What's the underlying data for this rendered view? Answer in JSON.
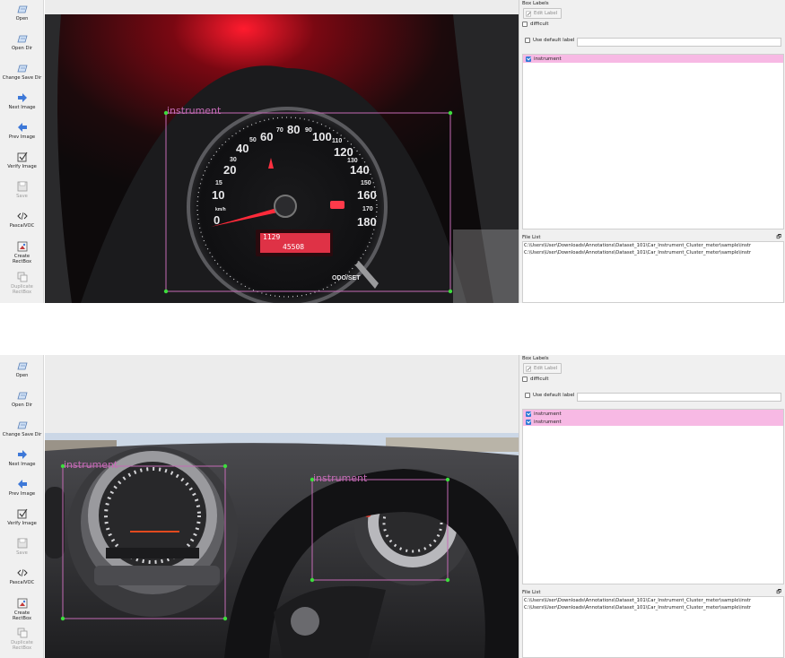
{
  "toolbar": {
    "items": [
      {
        "label": "Open",
        "icon": "folder-icon"
      },
      {
        "label": "Open Dir",
        "icon": "folder-icon"
      },
      {
        "label": "Change Save Dir",
        "icon": "folder-icon"
      },
      {
        "label": "Next Image",
        "icon": "arrow-right-icon"
      },
      {
        "label": "Prev Image",
        "icon": "arrow-left-icon"
      },
      {
        "label": "Verify Image",
        "icon": "checkbox-icon"
      },
      {
        "label": "Save",
        "icon": "save-icon"
      },
      {
        "label": "PascalVOC",
        "icon": "code-icon"
      },
      {
        "label": "Create\nRectBox",
        "icon": "create-rectbox-icon"
      },
      {
        "label": "Duplicate\nRectBox",
        "icon": "duplicate-icon"
      }
    ]
  },
  "dock": {
    "box_labels_title": "Box Labels",
    "edit_label": "Edit Label",
    "difficult": "difficult",
    "use_default_label": "Use default label",
    "file_list_title": "File List",
    "dock_button": "🗗"
  },
  "screens": [
    {
      "annotations": [
        {
          "label": "instrument"
        }
      ],
      "label_list": [
        "instrument"
      ],
      "files": [
        "C:\\Users\\User\\Downloads\\Annotations\\Dataset_101\\Car_Instrument_Cluster_meter\\sample\\instr",
        "C:\\Users\\User\\Downloads\\Annotations\\Dataset_101\\Car_Instrument_Cluster_meter\\sample\\instr"
      ],
      "photo": {
        "speed_ticks": [
          "0",
          "10",
          "15",
          "20",
          "30",
          "40",
          "50",
          "60",
          "70",
          "80",
          "90",
          "100",
          "110",
          "120",
          "130",
          "140",
          "150",
          "160",
          "170",
          "180"
        ],
        "unit": "km/h",
        "lcd_top": "1129",
        "lcd_bottom": "45508",
        "odo_label": "ODO/SET"
      }
    },
    {
      "annotations": [
        {
          "label": "instrument"
        },
        {
          "label": "instrument"
        }
      ],
      "label_list": [
        "instrument",
        "instrument"
      ],
      "files": [
        "C:\\Users\\User\\Downloads\\Annotations\\Dataset_101\\Car_Instrument_Cluster_meter\\sample\\instr",
        "C:\\Users\\User\\Downloads\\Annotations\\Dataset_101\\Car_Instrument_Cluster_meter\\sample\\instr"
      ]
    }
  ],
  "colors": {
    "annotation_box": "#c46bb5",
    "annotation_handle": "#3ddc3d",
    "label_highlight": "#f7b9e4"
  }
}
